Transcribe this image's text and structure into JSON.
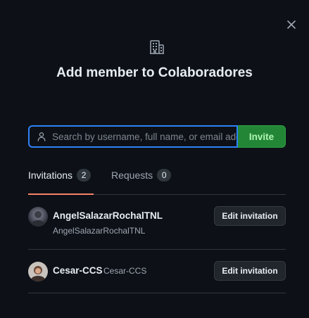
{
  "modal": {
    "title": "Add member to Colaboradores",
    "close_icon": "close-icon",
    "org_icon": "organization-icon"
  },
  "search": {
    "placeholder": "Search by username, full name, or email address",
    "value": "",
    "icon": "person-icon",
    "invite_label": "Invite"
  },
  "tabs": [
    {
      "label": "Invitations",
      "count": "2",
      "selected": true
    },
    {
      "label": "Requests",
      "count": "0",
      "selected": false
    }
  ],
  "colors": {
    "background": "#0d1117",
    "accent_focus": "#2f81f7",
    "invite_button": "#238636",
    "tab_underline": "#f78166"
  },
  "invitations": [
    {
      "name": "AngelSalazarRochalTNL",
      "login": "AngelSalazarRochalTNL",
      "action": "Edit invitation"
    },
    {
      "name": "Cesar-CCS",
      "login": "Cesar-CCS",
      "action": "Edit invitation"
    }
  ]
}
